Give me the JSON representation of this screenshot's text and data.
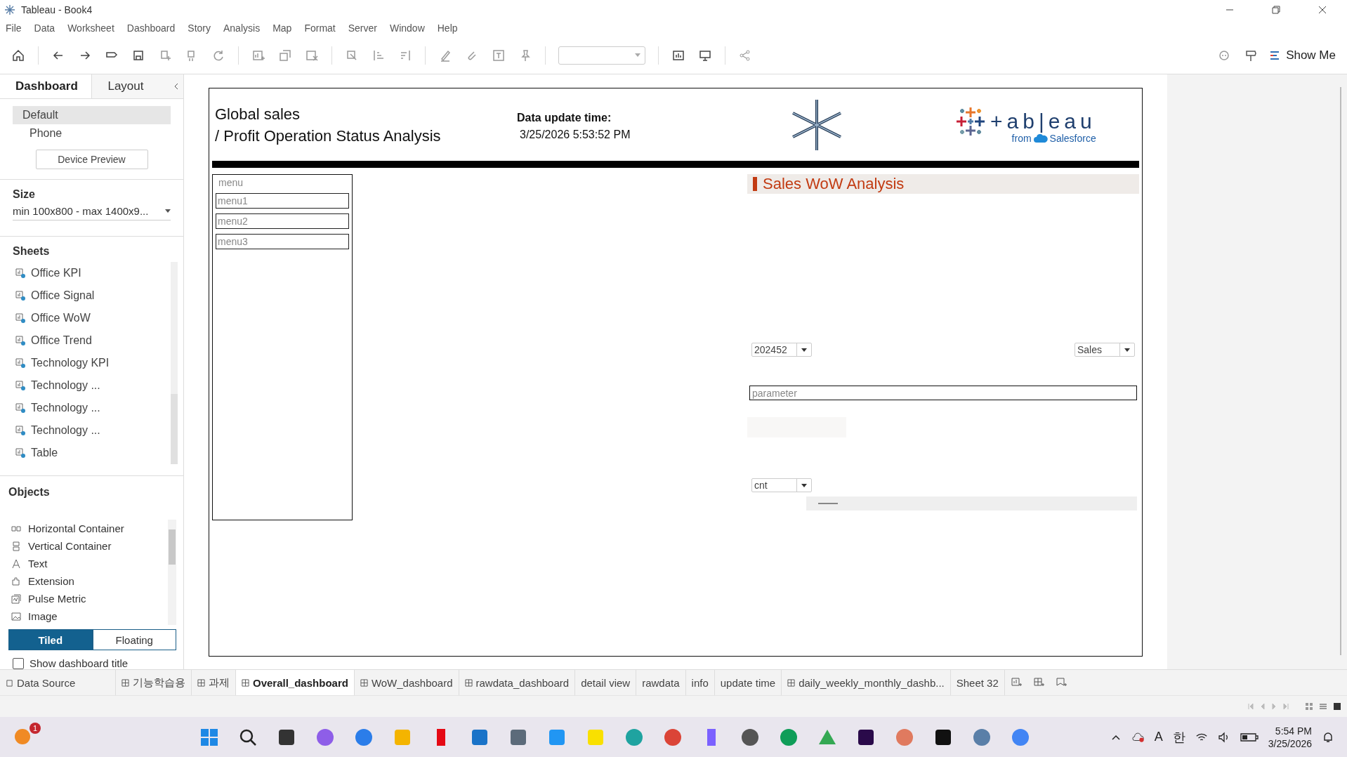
{
  "window": {
    "title": "Tableau - Book4"
  },
  "menu": [
    "File",
    "Data",
    "Worksheet",
    "Dashboard",
    "Story",
    "Analysis",
    "Map",
    "Format",
    "Server",
    "Window",
    "Help"
  ],
  "toolbar": {
    "show_me": "Show Me"
  },
  "side_tabs": [
    {
      "label": "Dashboard",
      "selected": true
    },
    {
      "label": "Layout",
      "selected": false
    }
  ],
  "devices": [
    {
      "label": "Default",
      "selected": true
    },
    {
      "label": "Phone",
      "selected": false
    }
  ],
  "device_preview": "Device Preview",
  "size": {
    "heading": "Size",
    "value": "min 100x800 - max 1400x9..."
  },
  "sheets": {
    "heading": "Sheets",
    "items": [
      "Office KPI",
      "Office Signal",
      "Office WoW",
      "Office Trend",
      "Technology KPI",
      "Technology ...",
      "Technology ...",
      "Technology ...",
      "Table"
    ]
  },
  "objects": {
    "heading": "Objects",
    "items": [
      {
        "label": "Horizontal Container",
        "kind": "hcontainer"
      },
      {
        "label": "Vertical Container",
        "kind": "vcontainer"
      },
      {
        "label": "Text",
        "kind": "text"
      },
      {
        "label": "Extension",
        "kind": "extension"
      },
      {
        "label": "Pulse Metric",
        "kind": "pulse"
      },
      {
        "label": "Image",
        "kind": "image"
      }
    ]
  },
  "placement": [
    {
      "label": "Tiled",
      "selected": true
    },
    {
      "label": "Floating",
      "selected": false
    }
  ],
  "show_title": {
    "label": "Show dashboard title",
    "checked": false
  },
  "dashboard": {
    "title_lines": [
      "Global sales",
      "/ Profit Operation Status Analysis"
    ],
    "update_label": "Data update time:",
    "update_value": "3/25/2026 5:53:52 PM",
    "logo": {
      "wordmark": "+ab|eau",
      "from": "from",
      "brand": "Salesforce"
    },
    "menu_panel": {
      "label": "menu",
      "items": [
        "menu1",
        "menu2",
        "menu3"
      ]
    },
    "wow": {
      "title": "Sales WoW Analysis",
      "filters": [
        "202452",
        "Sales"
      ],
      "parameter": {
        "placeholder": "parameter"
      },
      "count_filter": "cnt"
    }
  },
  "sheet_tabs": [
    {
      "label": "Data Source",
      "kind": "datasource",
      "selected": false
    },
    {
      "label": "기능학습용",
      "kind": "dashboard",
      "selected": false
    },
    {
      "label": "과제",
      "kind": "dashboard",
      "selected": false
    },
    {
      "label": "Overall_dashboard",
      "kind": "dashboard",
      "selected": true
    },
    {
      "label": "WoW_dashboard",
      "kind": "dashboard",
      "selected": false
    },
    {
      "label": "rawdata_dashboard",
      "kind": "dashboard",
      "selected": false
    },
    {
      "label": "detail view",
      "kind": "sheet",
      "selected": false
    },
    {
      "label": "rawdata",
      "kind": "sheet",
      "selected": false
    },
    {
      "label": "info",
      "kind": "sheet",
      "selected": false
    },
    {
      "label": "update time",
      "kind": "sheet",
      "selected": false
    },
    {
      "label": "daily_weekly_monthly_dashb...",
      "kind": "dashboard",
      "selected": false
    },
    {
      "label": "Sheet 32",
      "kind": "sheet",
      "selected": false
    }
  ],
  "taskbar": {
    "badge": "1",
    "ime": [
      "A",
      "한"
    ],
    "time": "5:54 PM",
    "date": "3/25/2026"
  }
}
